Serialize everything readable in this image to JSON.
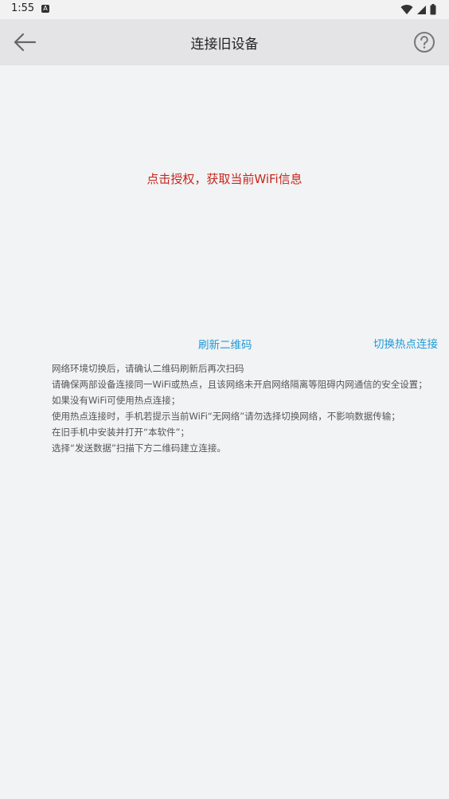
{
  "status_bar": {
    "time": "1:55",
    "notification_icon": "a-icon",
    "icons": [
      "wifi-icon",
      "signal-icon",
      "battery-icon"
    ]
  },
  "app_bar": {
    "title": "连接旧设备",
    "back_icon": "arrow-left-icon",
    "help_icon": "help-circle-icon"
  },
  "main": {
    "auth_link": "点击授权，获取当前WiFi信息",
    "refresh_link": "刷新二维码",
    "hotspot_link": "切换热点连接",
    "instructions": [
      "网络环境切换后，请确认二维码刷新后再次扫码",
      "请确保两部设备连接同一WiFi或热点，且该网络未开启网络隔离等阻碍内网通信的安全设置；",
      "如果没有WiFi可使用热点连接；",
      "使用热点连接时，手机若提示当前WiFi“无网络”请勿选择切换网络，不影响数据传输；",
      "在旧手机中安装并打开“本软件”；",
      "选择“发送数据”扫描下方二维码建立连接。"
    ]
  },
  "colors": {
    "auth_link": "#c4271d",
    "link_blue": "#1e9ad6",
    "app_bar_bg": "#e4e4e6",
    "page_bg": "#f2f3f5"
  }
}
